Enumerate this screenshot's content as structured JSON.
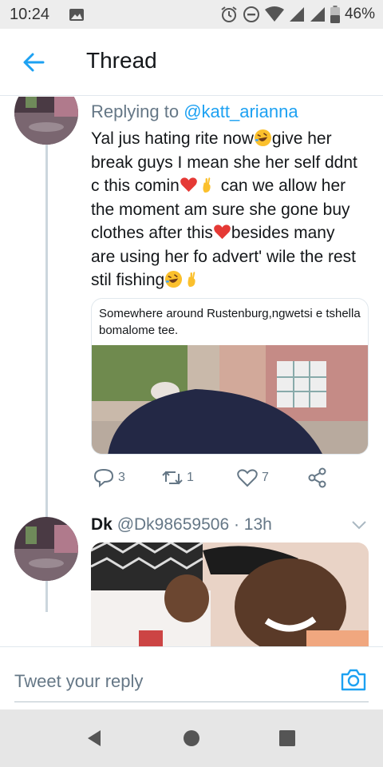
{
  "status_bar": {
    "time": "10:24",
    "battery": "46%",
    "icons": [
      "gallery-icon",
      "alarm-icon",
      "dnd-icon",
      "wifi-icon",
      "signal-icon",
      "signal-icon-2",
      "battery-icon"
    ]
  },
  "header": {
    "title": "Thread",
    "back_icon": "arrow-left-icon"
  },
  "tweet1": {
    "replying_prefix": "Replying to ",
    "replying_handle": "@katt_arianna",
    "lines": [
      "Yal jus hating rite now",
      "give her",
      "break guys I mean she her self ddnt",
      "c this comin",
      "can we allow her",
      "the moment am sure she gone buy",
      "clothes after this",
      "besides many",
      "are using her fo advert' wile the rest",
      "stil fishing"
    ],
    "emojis": [
      "rofl",
      "red-heart",
      "crossed-fingers"
    ],
    "card_text": "Somewhere around Rustenburg,ngwetsi e tshella bomalome tee.",
    "actions": {
      "reply_count": "3",
      "retweet_count": "1",
      "like_count": "7"
    }
  },
  "tweet2": {
    "name": "Dk",
    "handle_time": "@Dk98659506 · 13h"
  },
  "composer": {
    "placeholder": "Tweet your reply",
    "camera_icon": "camera-icon"
  },
  "nav_bar": {
    "buttons": [
      "back-triangle-icon",
      "home-circle-icon",
      "recents-square-icon"
    ]
  },
  "colors": {
    "accent": "#1da1f2",
    "muted": "#657786",
    "text": "#14171a",
    "heart": "#e0245e"
  }
}
